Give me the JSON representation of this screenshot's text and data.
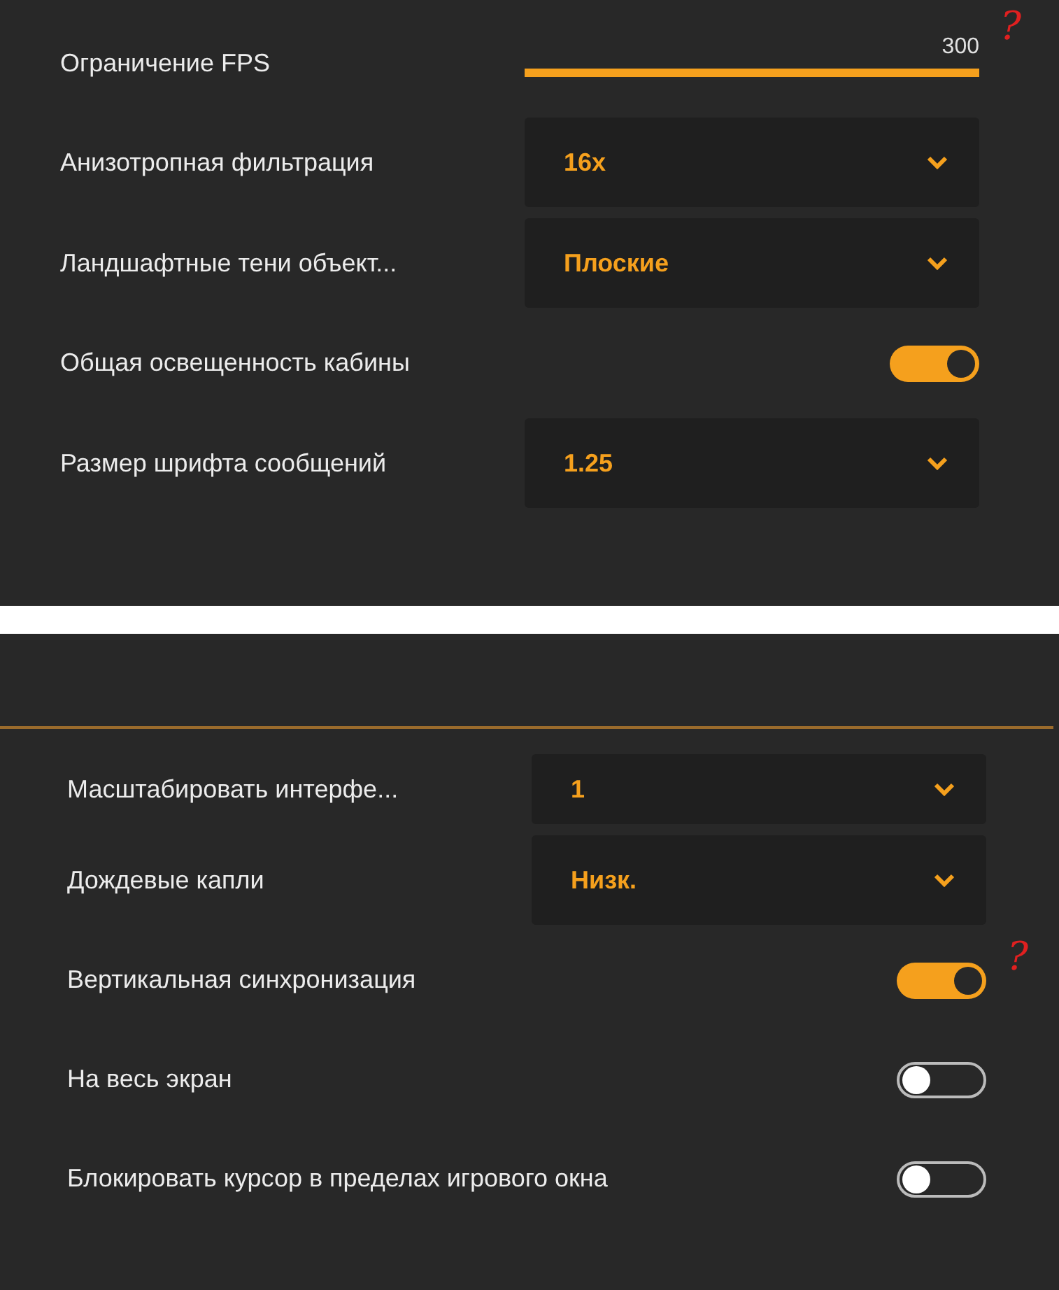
{
  "panels": [
    {
      "rows": [
        {
          "kind": "slider",
          "label": "Ограничение FPS",
          "reading": "300",
          "level": 1,
          "annotation": "?"
        },
        {
          "kind": "dropdown",
          "label": "Анизотропная фильтрация",
          "value": "16x"
        },
        {
          "kind": "dropdown",
          "label": "Ландшафтные тени объект...",
          "value": "Плоские"
        },
        {
          "kind": "toggle",
          "label": "Общая освещенность кабины",
          "on": true
        },
        {
          "kind": "dropdown",
          "label": "Размер шрифта сообщений",
          "value": "1.25"
        }
      ]
    },
    {
      "rows": [
        {
          "kind": "dropdown",
          "label": "Масштабировать интерфе...",
          "value": "1"
        },
        {
          "kind": "dropdown",
          "label": "Дождевые капли",
          "value": "Низк."
        },
        {
          "kind": "toggle",
          "label": "Вертикальная синхронизация",
          "on": true,
          "annotation": "?"
        },
        {
          "kind": "toggle",
          "label": "На весь экран",
          "on": false
        },
        {
          "kind": "toggle",
          "label": "Блокировать курсор в пределах игрового окна",
          "on": false
        }
      ]
    }
  ]
}
